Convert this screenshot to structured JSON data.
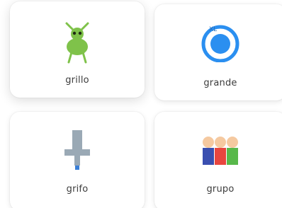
{
  "options": [
    {
      "word": "grillo",
      "icon": "cricket-icon"
    },
    {
      "word": "grande",
      "icon": "big-circle-icon"
    },
    {
      "word": "grifo",
      "icon": "faucet-icon"
    },
    {
      "word": "grupo",
      "icon": "group-of-people-icon"
    }
  ],
  "big_circle_icon_tag": "XL",
  "colors": {
    "card_bg": "#ffffff",
    "label_text": "#3c3c3c",
    "cricket_green": "#7fc24a",
    "circle_blue": "#2b8ff0",
    "faucet_gray": "#9aa9b5",
    "group_blue": "#3a4fb0",
    "group_red": "#e8463f",
    "group_green": "#58b84a",
    "group_skin": "#f5c9a0"
  }
}
